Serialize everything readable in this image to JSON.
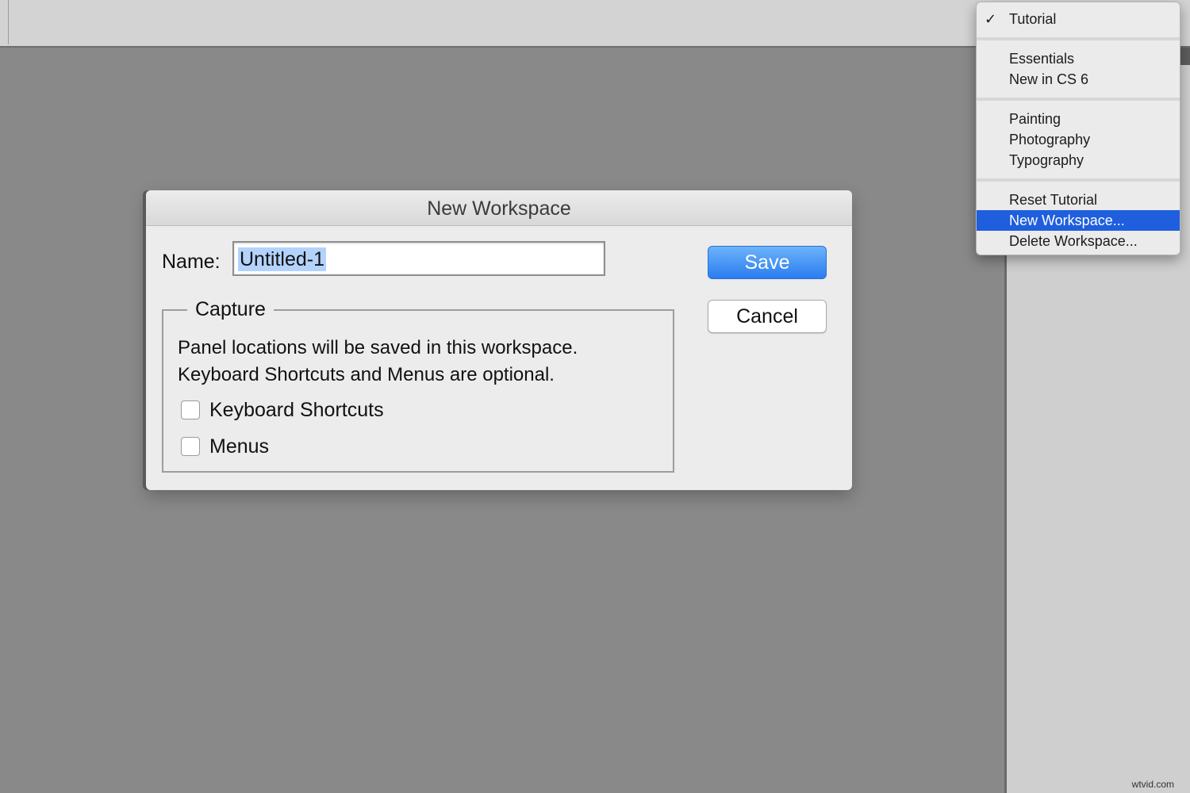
{
  "dialog": {
    "title": "New Workspace",
    "name_label": "Name:",
    "name_value": "Untitled-1",
    "save_label": "Save",
    "cancel_label": "Cancel",
    "capture": {
      "legend": "Capture",
      "desc_line1": "Panel locations will be saved in this workspace.",
      "desc_line2": "Keyboard Shortcuts and Menus are optional.",
      "keyboard_shortcuts_label": "Keyboard Shortcuts",
      "keyboard_shortcuts_checked": false,
      "menus_label": "Menus",
      "menus_checked": false
    }
  },
  "menu": {
    "checkmark": "✓",
    "items": [
      {
        "label": "Tutorial",
        "checked": true
      },
      {
        "label": "Essentials"
      },
      {
        "label": "New in CS 6"
      },
      {
        "label": "Painting"
      },
      {
        "label": "Photography"
      },
      {
        "label": "Typography"
      },
      {
        "label": "Reset Tutorial"
      },
      {
        "label": "New Workspace...",
        "highlighted": true
      },
      {
        "label": "Delete Workspace..."
      }
    ]
  },
  "watermark": "wtvid.com",
  "colors": {
    "accent": "#2a7df0",
    "menu_highlight": "#1f5fde",
    "canvas": "#898989"
  }
}
